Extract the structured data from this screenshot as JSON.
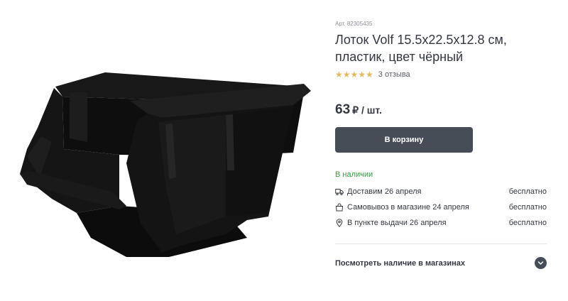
{
  "product": {
    "article": "Арт. 82305435",
    "title": "Лоток Volf 15.5x22.5x12.8 см, пластик, цвет чёрный",
    "image_icon": "storage-bin-image",
    "rating": {
      "stars": "★★★★★",
      "value": 5,
      "reviews": "3 отзыва"
    },
    "price": {
      "value": "63",
      "unit": "₽ / шт."
    },
    "cart_button": "В корзину",
    "stock": "В наличии"
  },
  "delivery": [
    {
      "icon": "truck-icon",
      "label": "Доставим 26 апреля",
      "price": "бесплатно"
    },
    {
      "icon": "bag-icon",
      "label": "Самовывоз в магазине 24 апреля",
      "price": "бесплатно"
    },
    {
      "icon": "location-pin-icon",
      "label": "В пункте выдачи 26 апреля",
      "price": "бесплатно"
    }
  ],
  "availability": {
    "label": "Посмотреть наличие в магазинах",
    "icon": "chevron-down-icon"
  },
  "colors": {
    "text": "#333840",
    "button_bg": "#474d57",
    "stock_green": "#2e9e3f",
    "stars": "#e4b85e",
    "muted": "#8a8f96"
  }
}
